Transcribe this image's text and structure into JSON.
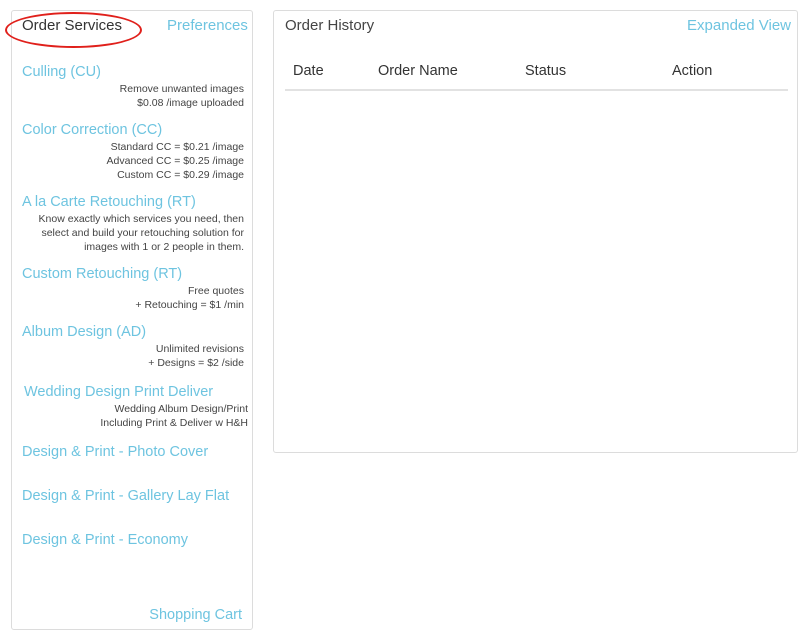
{
  "left_panel": {
    "tabs": {
      "order_services": "Order Services",
      "preferences": "Preferences"
    },
    "services": [
      {
        "title": "Culling (CU)",
        "desc": [
          "Remove unwanted images",
          "$0.08 /image uploaded"
        ]
      },
      {
        "title": "Color Correction (CC)",
        "desc": [
          "Standard CC = $0.21 /image",
          "Advanced CC = $0.25 /image",
          "Custom CC = $0.29 /image"
        ]
      },
      {
        "title": "A la Carte Retouching (RT)",
        "desc": [
          "Know exactly which services you need, then",
          "select and build your retouching solution for",
          "images with 1 or 2 people in them."
        ]
      },
      {
        "title": "Custom Retouching (RT)",
        "desc": [
          "Free quotes",
          "+ Retouching = $1 /min"
        ]
      },
      {
        "title": "Album Design (AD)",
        "desc": [
          "Unlimited revisions",
          "+ Designs = $2 /side"
        ]
      },
      {
        "title": "Wedding Design Print Deliver",
        "desc": [
          "Wedding Album Design/Print",
          "Including Print & Deliver w H&H"
        ]
      },
      {
        "title": "Design & Print - Photo Cover",
        "desc": []
      },
      {
        "title": "Design & Print - Gallery Lay Flat",
        "desc": []
      },
      {
        "title": "Design & Print - Economy",
        "desc": []
      }
    ],
    "shopping_cart": "Shopping Cart"
  },
  "order_history": {
    "title": "Order History",
    "expanded_view": "Expanded View",
    "columns": [
      "Date",
      "Order Name",
      "Status",
      "Action"
    ]
  },
  "colors": {
    "link": "#6ec4e0",
    "highlight_oval": "#e0201b",
    "border": "#dcdcdc"
  }
}
